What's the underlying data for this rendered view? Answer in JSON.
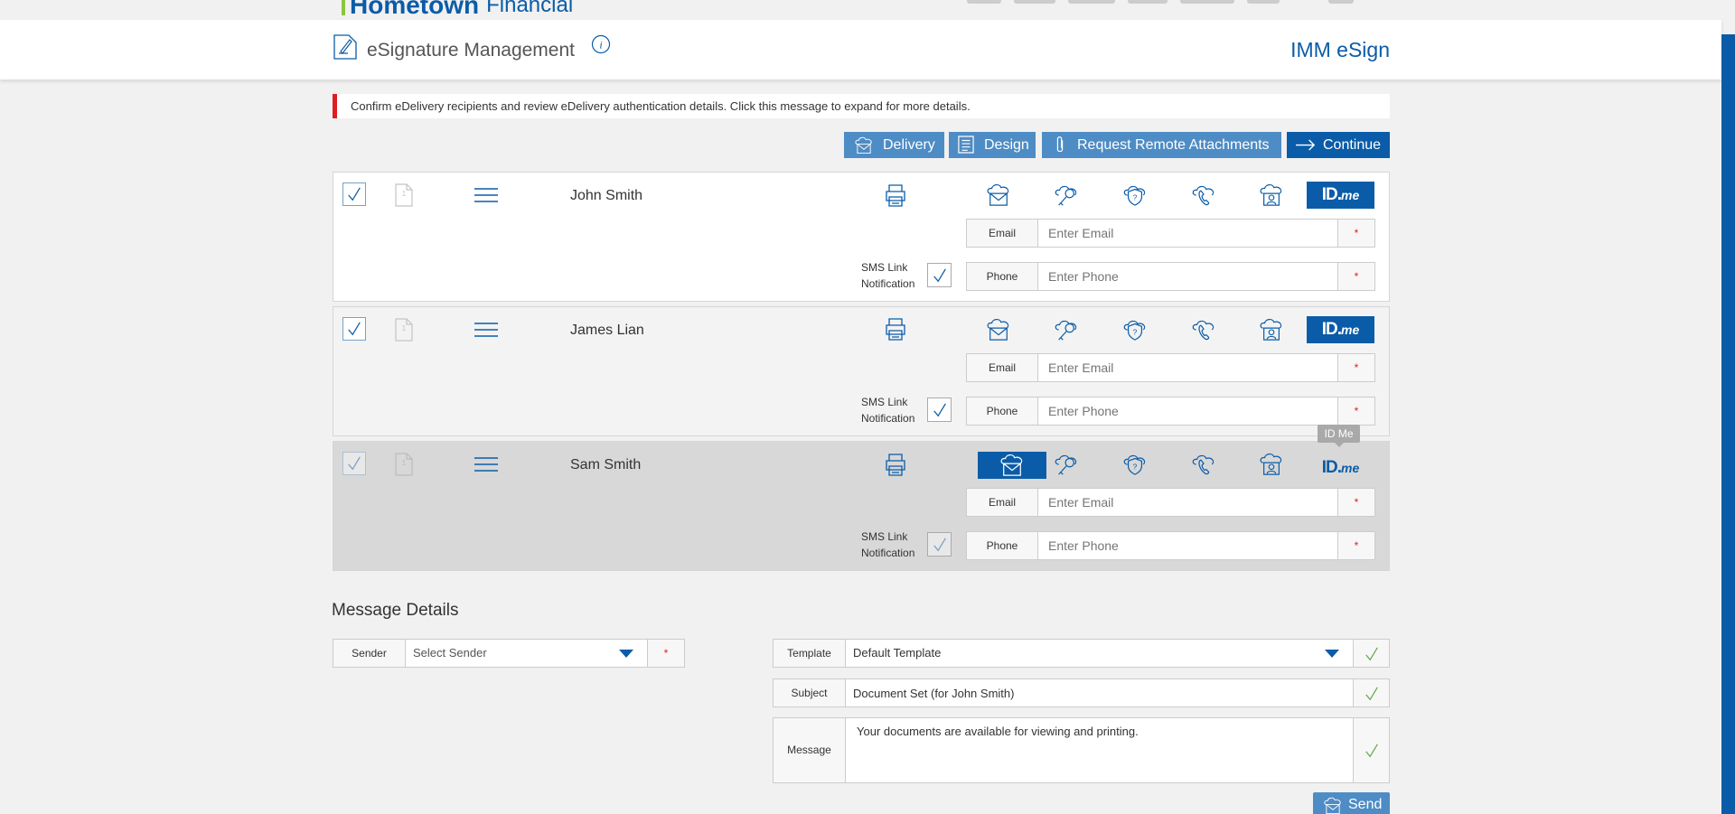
{
  "brand": {
    "name": "Hometown",
    "suffix": "Financial"
  },
  "header": {
    "title": "eSignature Management",
    "product": "IMM eSign"
  },
  "alert": {
    "text": "Confirm eDelivery recipients and review eDelivery authentication details. Click this message to expand for more details."
  },
  "toolbar": {
    "delivery": "Delivery",
    "design": "Design",
    "attachments": "Request Remote Attachments",
    "continue": "Continue"
  },
  "recipients": [
    {
      "name": "John Smith",
      "order": "1",
      "email_label": "Email",
      "email_placeholder": "Enter Email",
      "phone_label": "Phone",
      "phone_placeholder": "Enter Phone",
      "req_mark": "*",
      "sms_label": "SMS Link Notification",
      "idme": "ID.",
      "idme_suffix": "me"
    },
    {
      "name": "James Lian",
      "order": "1",
      "email_label": "Email",
      "email_placeholder": "Enter Email",
      "phone_label": "Phone",
      "phone_placeholder": "Enter Phone",
      "req_mark": "*",
      "sms_label": "SMS Link Notification",
      "idme": "ID.",
      "idme_suffix": "me"
    },
    {
      "name": "Sam Smith",
      "order": "1",
      "email_label": "Email",
      "email_placeholder": "Enter Email",
      "phone_label": "Phone",
      "phone_placeholder": "Enter Phone",
      "req_mark": "*",
      "sms_label": "SMS Link Notification",
      "idme": "ID.",
      "idme_suffix": "me"
    }
  ],
  "tooltip": {
    "text": "ID Me"
  },
  "message_details": {
    "title": "Message Details",
    "sender_label": "Sender",
    "sender_placeholder": "Select Sender",
    "req_mark": "*",
    "template_label": "Template",
    "template_value": "Default Template",
    "subject_label": "Subject",
    "subject_value": "Document Set (for John Smith)",
    "message_label": "Message",
    "message_value": "Your documents are available for viewing and printing.",
    "send": "Send"
  },
  "colors": {
    "brand_blue": "#0b5ca8",
    "button_light": "#4e8cc5",
    "alert_red": "#e11b22",
    "check_green": "#6aa84f",
    "brand_green": "#8cc43f"
  }
}
